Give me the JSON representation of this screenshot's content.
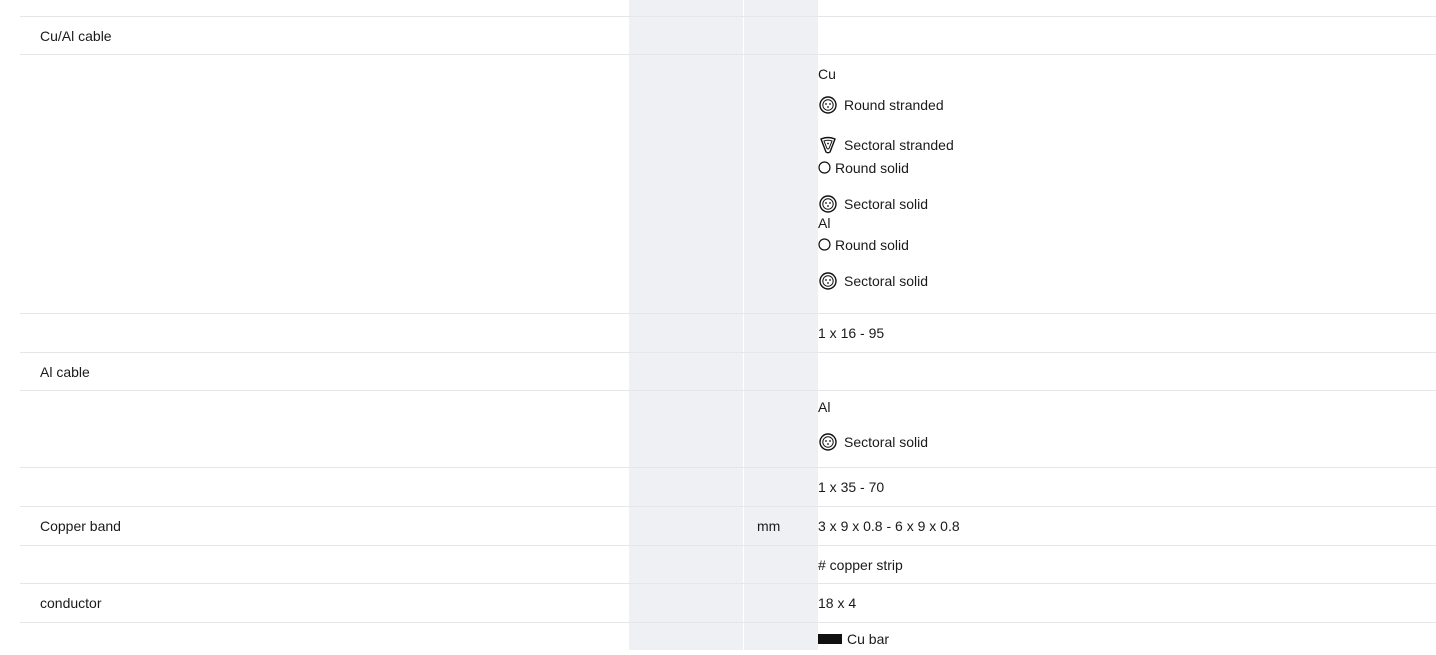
{
  "rows": [
    {
      "label": "Cu/Al cable",
      "unit": "",
      "value": ""
    },
    {
      "label": "",
      "unit": "",
      "cu_title": "Cu",
      "al_title": "Al",
      "cu_items": [
        "Round stranded",
        "Sectoral stranded",
        "Round solid",
        "Sectoral solid"
      ],
      "al_items": [
        "Round solid",
        "Sectoral solid"
      ]
    },
    {
      "label": "",
      "unit": "",
      "value": "1 x 16 - 95"
    },
    {
      "label": "Al cable",
      "unit": "",
      "value": ""
    },
    {
      "label": "",
      "unit": "",
      "al_title": "Al",
      "al_items": [
        "Sectoral solid"
      ]
    },
    {
      "label": "",
      "unit": "",
      "value": "1 x 35 - 70"
    },
    {
      "label": "Copper band",
      "unit": "mm",
      "value": "3 x 9 x 0.8 - 6 x 9 x 0.8"
    },
    {
      "label": "",
      "unit": "",
      "value": "# copper strip"
    },
    {
      "label": "conductor",
      "unit": "",
      "value": "18 x 4"
    },
    {
      "label": "",
      "unit": "",
      "value": "Cu bar"
    }
  ],
  "icons": {
    "round_stranded": "round-stranded-icon",
    "sectoral_stranded": "sectoral-stranded-icon",
    "round_solid": "round-solid-icon",
    "sectoral_solid": "sectoral-solid-icon",
    "cu_bar": "cu-bar-icon"
  },
  "colors": {
    "heading": "#1e72b8",
    "shade": "#eff0f3",
    "divider": "#e4e6ea"
  }
}
